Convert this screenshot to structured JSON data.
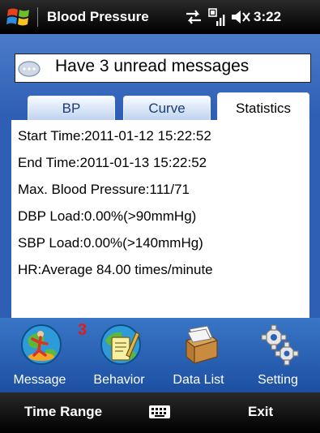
{
  "status_bar": {
    "title": "Blood Pressure",
    "time": "3:22",
    "icons": [
      "windows-logo",
      "sync-arrows",
      "signal-strength",
      "volume-muted"
    ]
  },
  "message_bar": {
    "text": "Have 3 unread messages",
    "icon": "chat-bubble-icon"
  },
  "tabs": [
    {
      "label": "BP",
      "active": false
    },
    {
      "label": "Curve",
      "active": false
    },
    {
      "label": "Statistics",
      "active": true
    }
  ],
  "statistics": {
    "lines": [
      "Start Time:2011-01-12 15:22:52",
      "End Time:2011-01-13 15:22:52",
      "Max. Blood Pressure:111/71",
      "DBP Load:0.00%(>90mmHg)",
      "SBP Load:0.00%(>140mmHg)",
      "HR:Average 84.00 times/minute"
    ]
  },
  "dock": {
    "items": [
      {
        "label": "Message",
        "icon": "globe-surfer-icon"
      },
      {
        "label": "Behavior",
        "icon": "globe-notepad-icon"
      },
      {
        "label": "Data List",
        "icon": "file-box-icon"
      },
      {
        "label": "Setting",
        "icon": "gears-icon"
      }
    ],
    "message_badge": "3"
  },
  "softkeys": {
    "left": "Time Range",
    "right": "Exit",
    "center_icon": "keyboard-icon"
  },
  "colors": {
    "content_blue": "#2f5fb4",
    "dock_blue": "#2a62b8",
    "badge_red": "#e31b1b"
  }
}
